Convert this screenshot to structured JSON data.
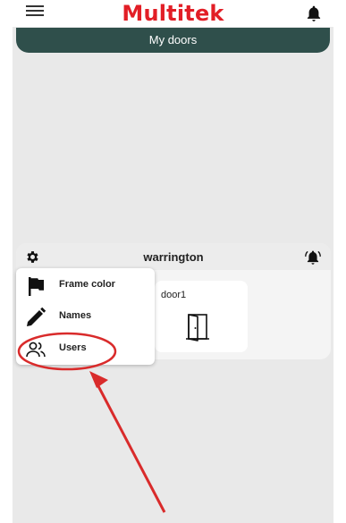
{
  "app": {
    "logo_text": "Multitek"
  },
  "banner": {
    "title": "My doors"
  },
  "group": {
    "name": "warrington",
    "doors": [
      {
        "label": "door1"
      }
    ]
  },
  "context_menu": {
    "items": [
      {
        "label": "Frame color",
        "icon": "flag-icon"
      },
      {
        "label": "Names",
        "icon": "pencil-icon"
      },
      {
        "label": "Users",
        "icon": "users-icon"
      }
    ]
  },
  "colors": {
    "brand_red": "#e21e26",
    "banner_bg": "#2f4f4b",
    "annotation_red": "#d92b2b"
  },
  "icons": [
    "menu-icon",
    "bell-icon",
    "gear-icon",
    "alarm-bell-icon",
    "door-icon",
    "flag-icon",
    "pencil-icon",
    "users-icon"
  ]
}
